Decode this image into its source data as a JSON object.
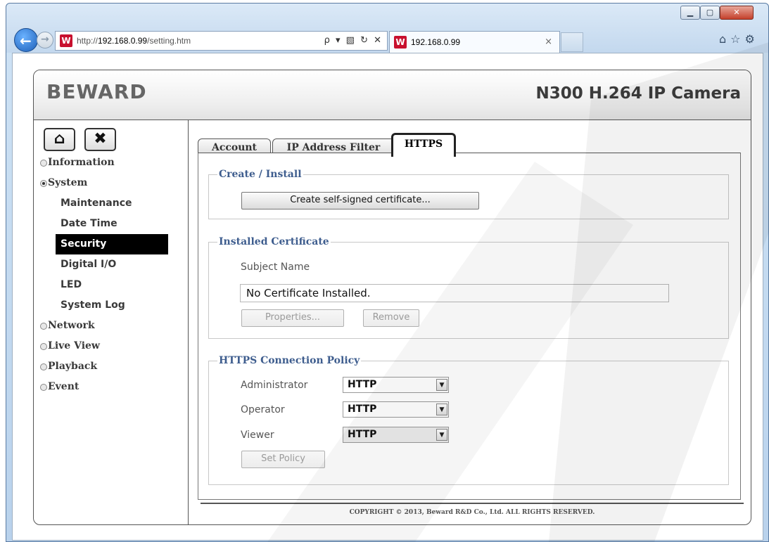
{
  "browser": {
    "url_prefix": "http://",
    "url_host": "192.168.0.99",
    "url_path": "/setting.htm",
    "address_actions": "ρ ▾ ▧ ↻ ✕",
    "tab_title": "192.168.0.99",
    "tab_close": "×",
    "favicon_letter": "W",
    "window_controls": {
      "minimize": "▁",
      "maximize": "▢",
      "close": "✕"
    },
    "nav_back": "←",
    "nav_forward": "→",
    "right_icons": "⌂☆⚙"
  },
  "header": {
    "logo": "BEWARD",
    "product": "N300 H.264 IP Camera"
  },
  "sidebar": {
    "home_icon": "⌂",
    "tools_icon": "✖",
    "items": [
      {
        "label": "Information"
      },
      {
        "label": "System"
      },
      {
        "label": "Network"
      },
      {
        "label": "Live View"
      },
      {
        "label": "Playback"
      },
      {
        "label": "Event"
      }
    ],
    "system_sub": [
      "Maintenance",
      "Date Time",
      "Security",
      "Digital I/O",
      "LED",
      "System Log"
    ]
  },
  "tabs": [
    "Account",
    "IP Address Filter",
    "HTTPS"
  ],
  "create_install": {
    "legend": "Create / Install",
    "button": "Create self-signed certificate..."
  },
  "installed": {
    "legend": "Installed Certificate",
    "subject_label": "Subject Name",
    "subject_value": "No Certificate Installed.",
    "properties_button": "Properties...",
    "remove_button": "Remove"
  },
  "policy": {
    "legend": "HTTPS Connection Policy",
    "rows": [
      {
        "label": "Administrator",
        "value": "HTTP"
      },
      {
        "label": "Operator",
        "value": "HTTP"
      },
      {
        "label": "Viewer",
        "value": "HTTP"
      }
    ],
    "set_button": "Set Policy"
  },
  "footer": "COPYRIGHT © 2013, Beward R&D Co., Ltd. ALL RIGHTS RESERVED."
}
